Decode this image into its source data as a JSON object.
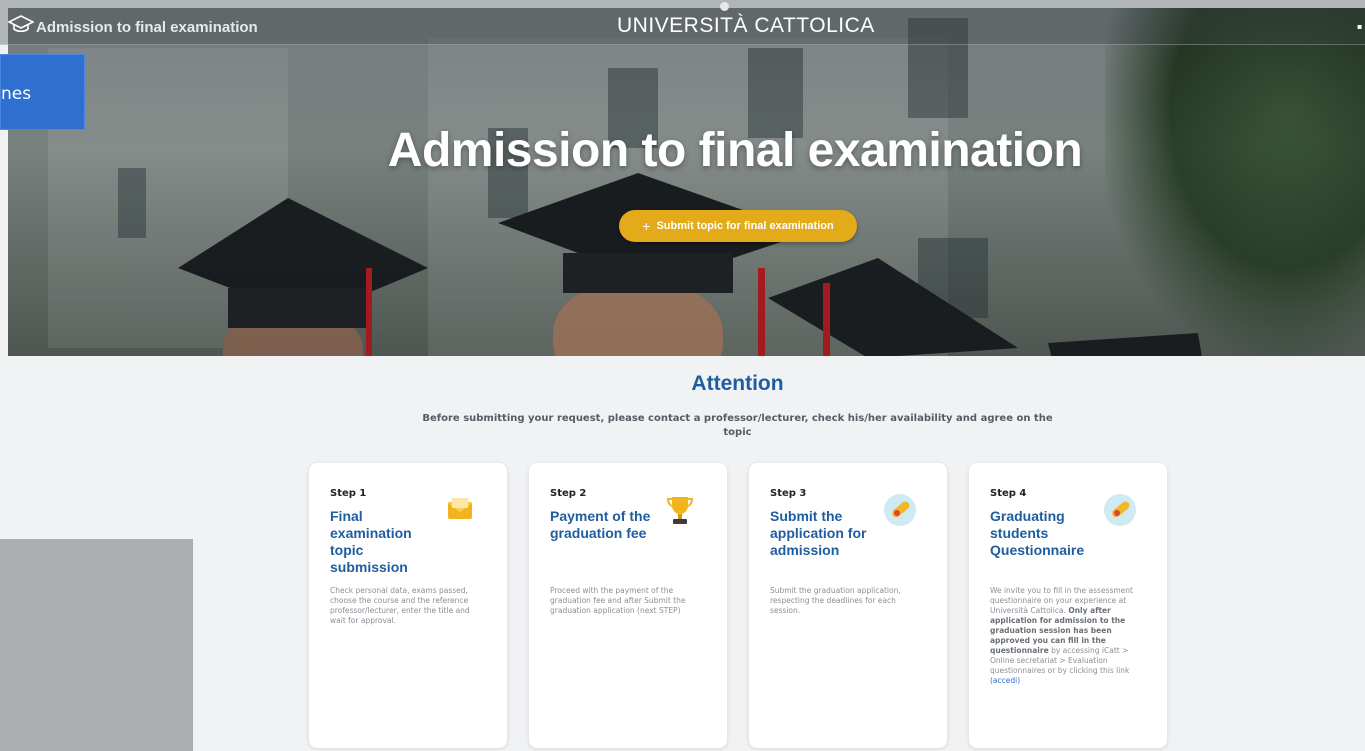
{
  "topbar": {
    "title": "Admission to final examination",
    "brand": "UNIVERSITÀ CATTOLICA"
  },
  "side_tab": {
    "label": "nes"
  },
  "hero": {
    "title": "Admission to final examination",
    "button_icon": "+",
    "button_label": "Submit topic for final examination",
    "accent": "#e3ab19"
  },
  "attention": {
    "title": "Attention",
    "text": "Before submitting your request, please contact a professor/lecturer, check his/her availability and agree on the topic"
  },
  "steps": [
    {
      "step": "Step 1",
      "title": "Final examination topic submission",
      "icon": "envelope-icon",
      "description": "Check personal data, exams passed, choose the course and the reference professor/lecturer, enter the title and wait for approval."
    },
    {
      "step": "Step 2",
      "title": "Payment of the graduation fee",
      "icon": "trophy-icon",
      "description": "Proceed with the payment of the graduation fee and after Submit the graduation application (next STEP)"
    },
    {
      "step": "Step 3",
      "title": "Submit the application for admission",
      "icon": "diploma-icon",
      "description": "Submit the graduation application, respecting the deadlines for each session."
    },
    {
      "step": "Step 4",
      "title": "Graduating students Questionnaire",
      "icon": "diploma-icon",
      "description_1": "We invite you to fill in the assessment questionnaire on your experience at Università Cattolica.",
      "description_bold": "Only after application for admission to the graduation session has been approved you can fill in the questionnaire",
      "description_2": "by accessing iCatt > Online secretariat > Evaluation questionnaires or by clicking this link",
      "link": "(accedi)"
    }
  ],
  "colors": {
    "primary": "#1f5d9e",
    "link": "#2c6fd1",
    "side_tab": "#2f6fd0"
  }
}
